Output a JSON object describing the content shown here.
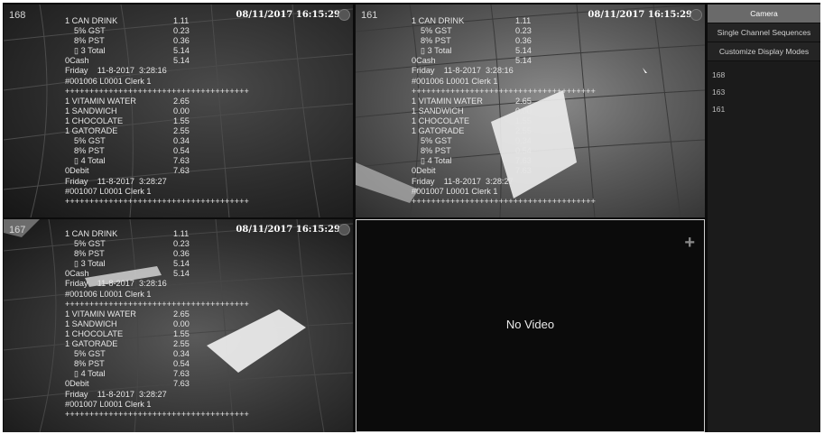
{
  "tiles": [
    {
      "id": "168",
      "timestamp": "08/11/2017 16:15:29"
    },
    {
      "id": "161",
      "timestamp": "08/11/2017 16:15:29"
    },
    {
      "id": "167",
      "timestamp": "08/11/2017 16:15:29"
    }
  ],
  "receipt": [
    {
      "text": "1 CAN DRINK",
      "amt": "1.11"
    },
    {
      "text": "5% GST",
      "amt": "0.23",
      "indent": true
    },
    {
      "text": "8% PST",
      "amt": "0.36",
      "indent": true
    },
    {
      "text": "▯ 3 Total",
      "amt": "5.14",
      "indent": true
    },
    {
      "text": "0Cash",
      "amt": "5.14"
    },
    {
      "text": "Friday    11-8-2017  3:28:16"
    },
    {
      "text": "#001006 L0001 Clerk 1"
    },
    {
      "text": "++++++++++++++++++++++++++++++++++++++"
    },
    {
      "text": "1 VITAMIN WATER",
      "amt": "2.65"
    },
    {
      "text": "1 SANDWICH",
      "amt": "0.00"
    },
    {
      "text": "1 CHOCOLATE",
      "amt": "1.55"
    },
    {
      "text": "1 GATORADE",
      "amt": "2.55"
    },
    {
      "text": "5% GST",
      "amt": "0.34",
      "indent": true
    },
    {
      "text": "8% PST",
      "amt": "0.54",
      "indent": true
    },
    {
      "text": "▯ 4 Total",
      "amt": "7.63",
      "indent": true
    },
    {
      "text": "0Debit",
      "amt": "7.63"
    },
    {
      "text": "Friday    11-8-2017  3:28:27"
    },
    {
      "text": "#001007 L0001 Clerk 1"
    },
    {
      "text": "++++++++++++++++++++++++++++++++++++++"
    }
  ],
  "no_video": "No Video",
  "sidebar": {
    "buttons": [
      "Camera",
      "Single Channel Sequences",
      "Customize Display Modes"
    ],
    "channels": [
      "168",
      "163",
      "161"
    ]
  },
  "colors": {
    "background": "#0c0c0c",
    "active_button": "#6a6a6a"
  }
}
